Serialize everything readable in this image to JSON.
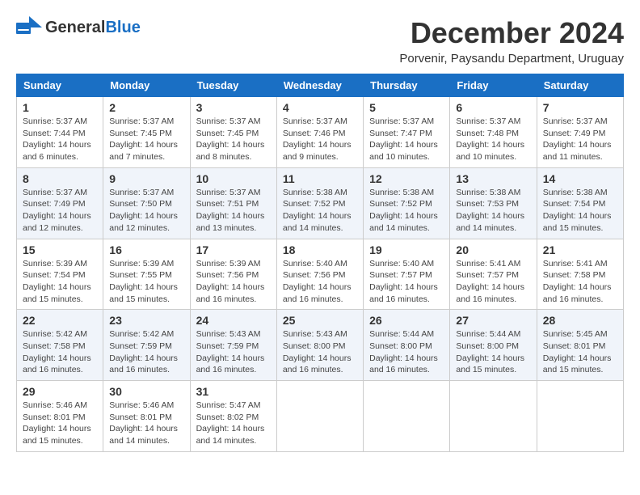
{
  "logo": {
    "general": "General",
    "blue": "Blue"
  },
  "title": "December 2024",
  "location": "Porvenir, Paysandu Department, Uruguay",
  "weekdays": [
    "Sunday",
    "Monday",
    "Tuesday",
    "Wednesday",
    "Thursday",
    "Friday",
    "Saturday"
  ],
  "weeks": [
    [
      {
        "day": "1",
        "sunrise": "5:37 AM",
        "sunset": "7:44 PM",
        "daylight": "14 hours and 6 minutes."
      },
      {
        "day": "2",
        "sunrise": "5:37 AM",
        "sunset": "7:45 PM",
        "daylight": "14 hours and 7 minutes."
      },
      {
        "day": "3",
        "sunrise": "5:37 AM",
        "sunset": "7:45 PM",
        "daylight": "14 hours and 8 minutes."
      },
      {
        "day": "4",
        "sunrise": "5:37 AM",
        "sunset": "7:46 PM",
        "daylight": "14 hours and 9 minutes."
      },
      {
        "day": "5",
        "sunrise": "5:37 AM",
        "sunset": "7:47 PM",
        "daylight": "14 hours and 10 minutes."
      },
      {
        "day": "6",
        "sunrise": "5:37 AM",
        "sunset": "7:48 PM",
        "daylight": "14 hours and 10 minutes."
      },
      {
        "day": "7",
        "sunrise": "5:37 AM",
        "sunset": "7:49 PM",
        "daylight": "14 hours and 11 minutes."
      }
    ],
    [
      {
        "day": "8",
        "sunrise": "5:37 AM",
        "sunset": "7:49 PM",
        "daylight": "14 hours and 12 minutes."
      },
      {
        "day": "9",
        "sunrise": "5:37 AM",
        "sunset": "7:50 PM",
        "daylight": "14 hours and 12 minutes."
      },
      {
        "day": "10",
        "sunrise": "5:37 AM",
        "sunset": "7:51 PM",
        "daylight": "14 hours and 13 minutes."
      },
      {
        "day": "11",
        "sunrise": "5:38 AM",
        "sunset": "7:52 PM",
        "daylight": "14 hours and 14 minutes."
      },
      {
        "day": "12",
        "sunrise": "5:38 AM",
        "sunset": "7:52 PM",
        "daylight": "14 hours and 14 minutes."
      },
      {
        "day": "13",
        "sunrise": "5:38 AM",
        "sunset": "7:53 PM",
        "daylight": "14 hours and 14 minutes."
      },
      {
        "day": "14",
        "sunrise": "5:38 AM",
        "sunset": "7:54 PM",
        "daylight": "14 hours and 15 minutes."
      }
    ],
    [
      {
        "day": "15",
        "sunrise": "5:39 AM",
        "sunset": "7:54 PM",
        "daylight": "14 hours and 15 minutes."
      },
      {
        "day": "16",
        "sunrise": "5:39 AM",
        "sunset": "7:55 PM",
        "daylight": "14 hours and 15 minutes."
      },
      {
        "day": "17",
        "sunrise": "5:39 AM",
        "sunset": "7:56 PM",
        "daylight": "14 hours and 16 minutes."
      },
      {
        "day": "18",
        "sunrise": "5:40 AM",
        "sunset": "7:56 PM",
        "daylight": "14 hours and 16 minutes."
      },
      {
        "day": "19",
        "sunrise": "5:40 AM",
        "sunset": "7:57 PM",
        "daylight": "14 hours and 16 minutes."
      },
      {
        "day": "20",
        "sunrise": "5:41 AM",
        "sunset": "7:57 PM",
        "daylight": "14 hours and 16 minutes."
      },
      {
        "day": "21",
        "sunrise": "5:41 AM",
        "sunset": "7:58 PM",
        "daylight": "14 hours and 16 minutes."
      }
    ],
    [
      {
        "day": "22",
        "sunrise": "5:42 AM",
        "sunset": "7:58 PM",
        "daylight": "14 hours and 16 minutes."
      },
      {
        "day": "23",
        "sunrise": "5:42 AM",
        "sunset": "7:59 PM",
        "daylight": "14 hours and 16 minutes."
      },
      {
        "day": "24",
        "sunrise": "5:43 AM",
        "sunset": "7:59 PM",
        "daylight": "14 hours and 16 minutes."
      },
      {
        "day": "25",
        "sunrise": "5:43 AM",
        "sunset": "8:00 PM",
        "daylight": "14 hours and 16 minutes."
      },
      {
        "day": "26",
        "sunrise": "5:44 AM",
        "sunset": "8:00 PM",
        "daylight": "14 hours and 16 minutes."
      },
      {
        "day": "27",
        "sunrise": "5:44 AM",
        "sunset": "8:00 PM",
        "daylight": "14 hours and 15 minutes."
      },
      {
        "day": "28",
        "sunrise": "5:45 AM",
        "sunset": "8:01 PM",
        "daylight": "14 hours and 15 minutes."
      }
    ],
    [
      {
        "day": "29",
        "sunrise": "5:46 AM",
        "sunset": "8:01 PM",
        "daylight": "14 hours and 15 minutes."
      },
      {
        "day": "30",
        "sunrise": "5:46 AM",
        "sunset": "8:01 PM",
        "daylight": "14 hours and 14 minutes."
      },
      {
        "day": "31",
        "sunrise": "5:47 AM",
        "sunset": "8:02 PM",
        "daylight": "14 hours and 14 minutes."
      },
      null,
      null,
      null,
      null
    ]
  ],
  "labels": {
    "sunrise": "Sunrise:",
    "sunset": "Sunset:",
    "daylight": "Daylight:"
  }
}
